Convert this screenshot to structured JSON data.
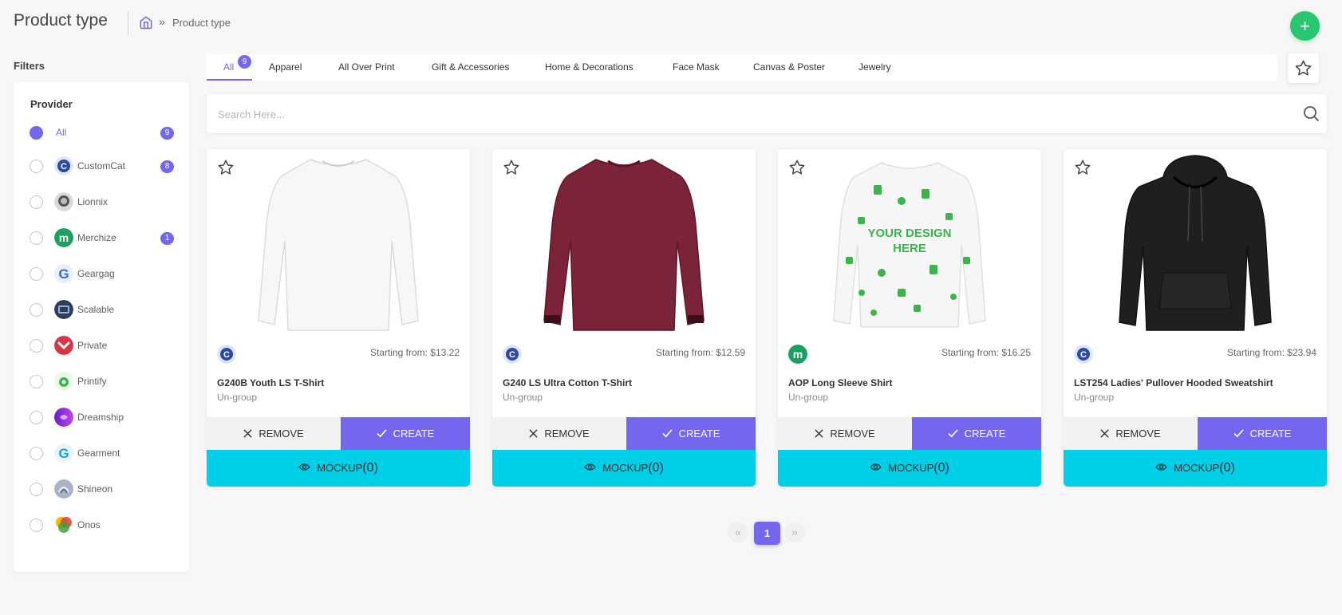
{
  "header": {
    "title": "Product type",
    "breadcrumb_home_icon": "home-icon",
    "breadcrumb_sep": "»",
    "breadcrumb_current": "Product type",
    "add_label": "+"
  },
  "filters": {
    "label": "Filters",
    "provider_heading": "Provider",
    "providers": [
      {
        "name": "All",
        "count": "9",
        "checked": true
      },
      {
        "name": "CustomCat",
        "count": "8",
        "logo": "customcat-logo"
      },
      {
        "name": "Lionnix",
        "logo": "lionnix-logo"
      },
      {
        "name": "Merchize",
        "count": "1",
        "logo": "merchize-logo"
      },
      {
        "name": "Geargag",
        "logo": "geargag-logo"
      },
      {
        "name": "Scalable",
        "logo": "scalable-logo"
      },
      {
        "name": "Private",
        "logo": "private-logo"
      },
      {
        "name": "Printify",
        "logo": "printify-logo"
      },
      {
        "name": "Dreamship",
        "logo": "dreamship-logo"
      },
      {
        "name": "Gearment",
        "logo": "gearment-logo"
      },
      {
        "name": "Shineon",
        "logo": "shineon-logo"
      },
      {
        "name": "Onos",
        "logo": "onos-logo"
      }
    ]
  },
  "tabs": {
    "items": [
      "All",
      "Apparel",
      "All Over Print",
      "Gift & Accessories",
      "Home & Decorations",
      "Face Mask",
      "Canvas & Poster",
      "Jewelry"
    ],
    "active": "All",
    "all_count": "9"
  },
  "search": {
    "placeholder": "Search Here..."
  },
  "products": [
    {
      "name": "G240B Youth LS T-Shirt",
      "price": "Starting from: $13.22",
      "group": "Un-group",
      "provider": "customcat",
      "color": "#f4f4f4"
    },
    {
      "name": "G240 LS Ultra Cotton T-Shirt",
      "price": "Starting from: $12.59",
      "group": "Un-group",
      "provider": "customcat",
      "color": "#7b2337"
    },
    {
      "name": "AOP Long Sleeve Shirt",
      "price": "Starting from: $16.25",
      "group": "Un-group",
      "provider": "merchize",
      "color": "#f6f6f6"
    },
    {
      "name": "LST254 Ladies' Pullover Hooded Sweatshirt",
      "price": "Starting from: $23.94",
      "group": "Un-group",
      "provider": "customcat",
      "color": "#1c1c1c"
    }
  ],
  "buttons": {
    "remove": "REMOVE",
    "create": "CREATE",
    "mockup": "MOCKUP",
    "mockup_count": "(0)"
  },
  "pagination": {
    "prev": "«",
    "current": "1",
    "next": "»"
  },
  "colors": {
    "accent": "#7367f0",
    "success": "#28c76f",
    "mockup": "#00cfe8"
  }
}
